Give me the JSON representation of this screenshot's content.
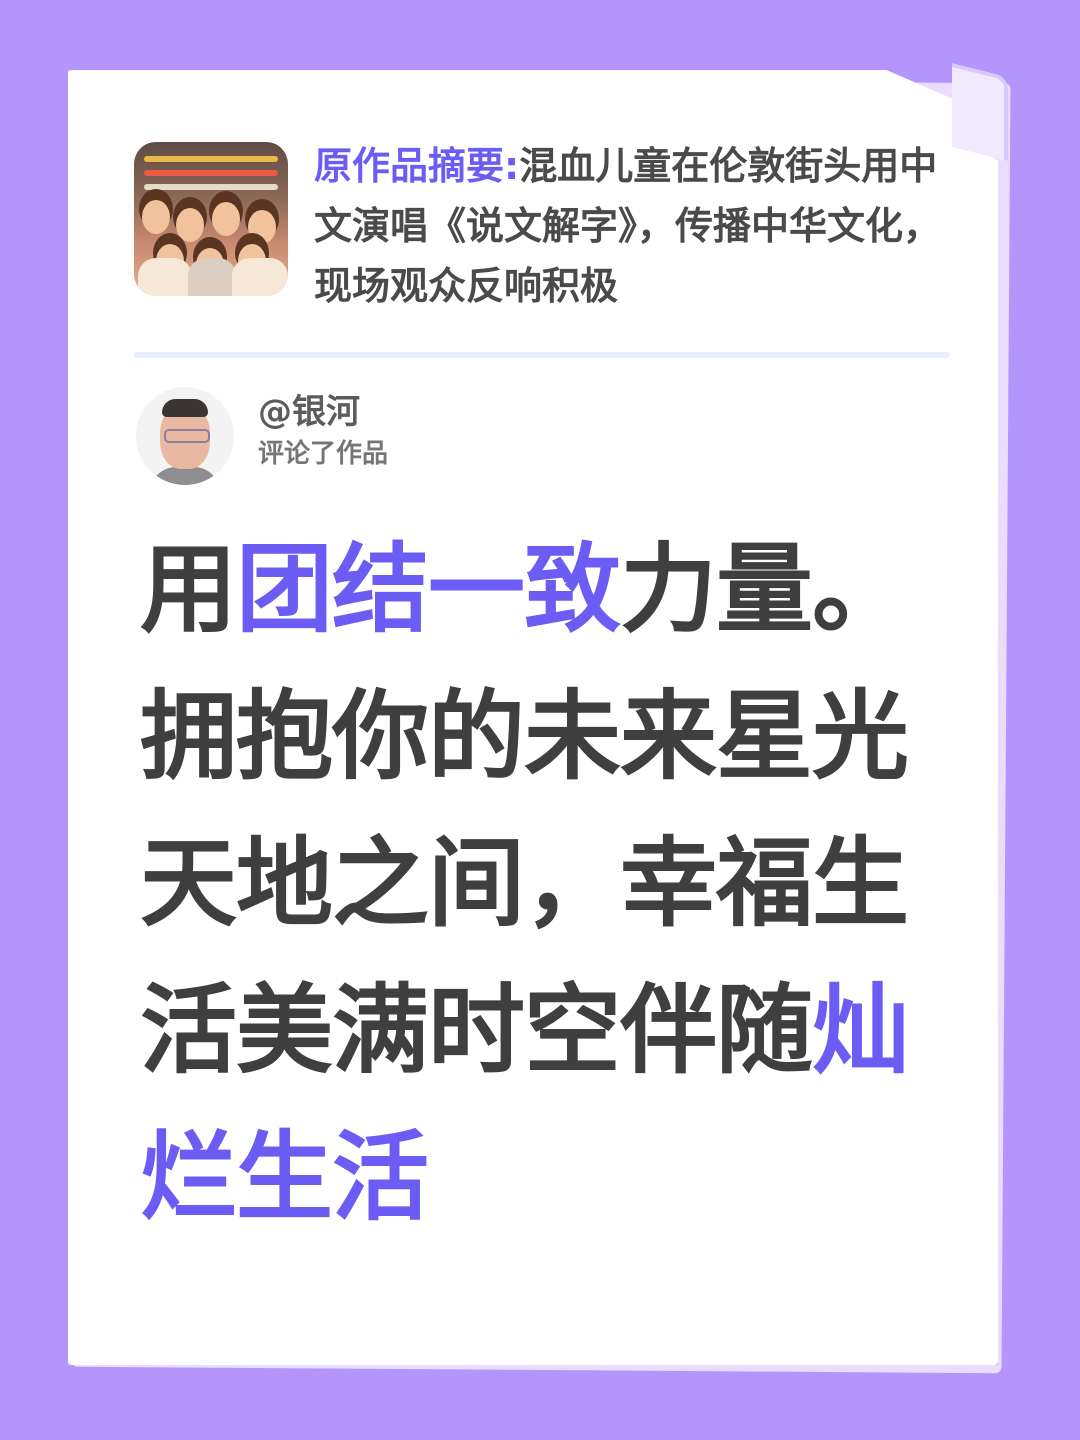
{
  "summary": {
    "label": "原作品摘要:",
    "text": "混血儿童在伦敦街头用中文演唱《说文解字》，传播中华文化，现场观众反响积极"
  },
  "comment": {
    "username": "@银河",
    "action": "评论了作品"
  },
  "poem": {
    "line1_a": "用",
    "line1_hl": "团结一致",
    "line1_b": "力量。",
    "line2": "拥抱你的未来星光",
    "line3": "天地之间，幸福生",
    "line4_a": "活美满时空伴随",
    "line4_hl": "灿",
    "line5_hl": "烂生活"
  },
  "colors": {
    "background": "#b495fb",
    "accent": "#6b5df3",
    "text": "#3f3f3f"
  }
}
